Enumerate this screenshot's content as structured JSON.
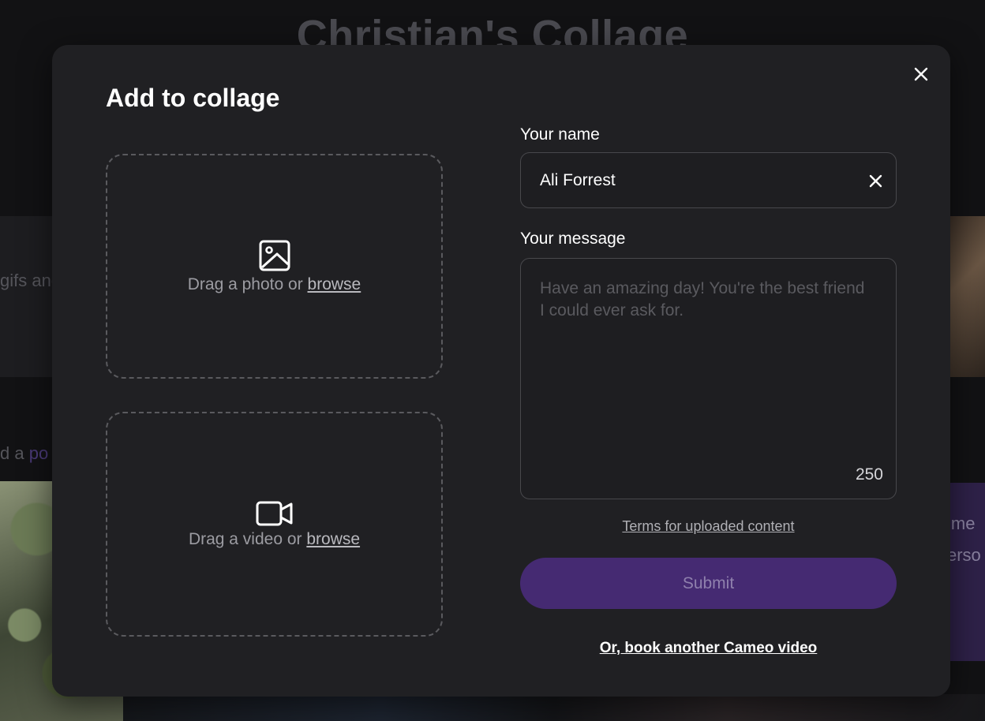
{
  "background": {
    "title": "Christian's Collage",
    "left_text_1": "gifs and",
    "left_text_2_prefix": "d a ",
    "left_text_2_accent": "po",
    "right_text_1": "ime",
    "right_text_2": "erso"
  },
  "modal": {
    "title": "Add to collage",
    "close_icon": "close-icon",
    "photo_drop": {
      "icon": "image-icon",
      "text": "Drag a photo or ",
      "link": "browse"
    },
    "video_drop": {
      "icon": "video-camera-icon",
      "text": "Drag a video or ",
      "link": "browse"
    },
    "name_field": {
      "label": "Your name",
      "value": "Ali Forrest",
      "clear_icon": "clear-icon"
    },
    "message_field": {
      "label": "Your message",
      "placeholder": "Have an amazing day! You're the best friend I could ever ask for.",
      "char_count": "250"
    },
    "terms_link": "Terms for uploaded content",
    "submit_label": "Submit",
    "book_link": "Or, book another Cameo video"
  },
  "colors": {
    "modal_bg": "#202023",
    "page_bg": "#121214",
    "submit_bg": "#452a72",
    "submit_text": "#8f80ad"
  }
}
